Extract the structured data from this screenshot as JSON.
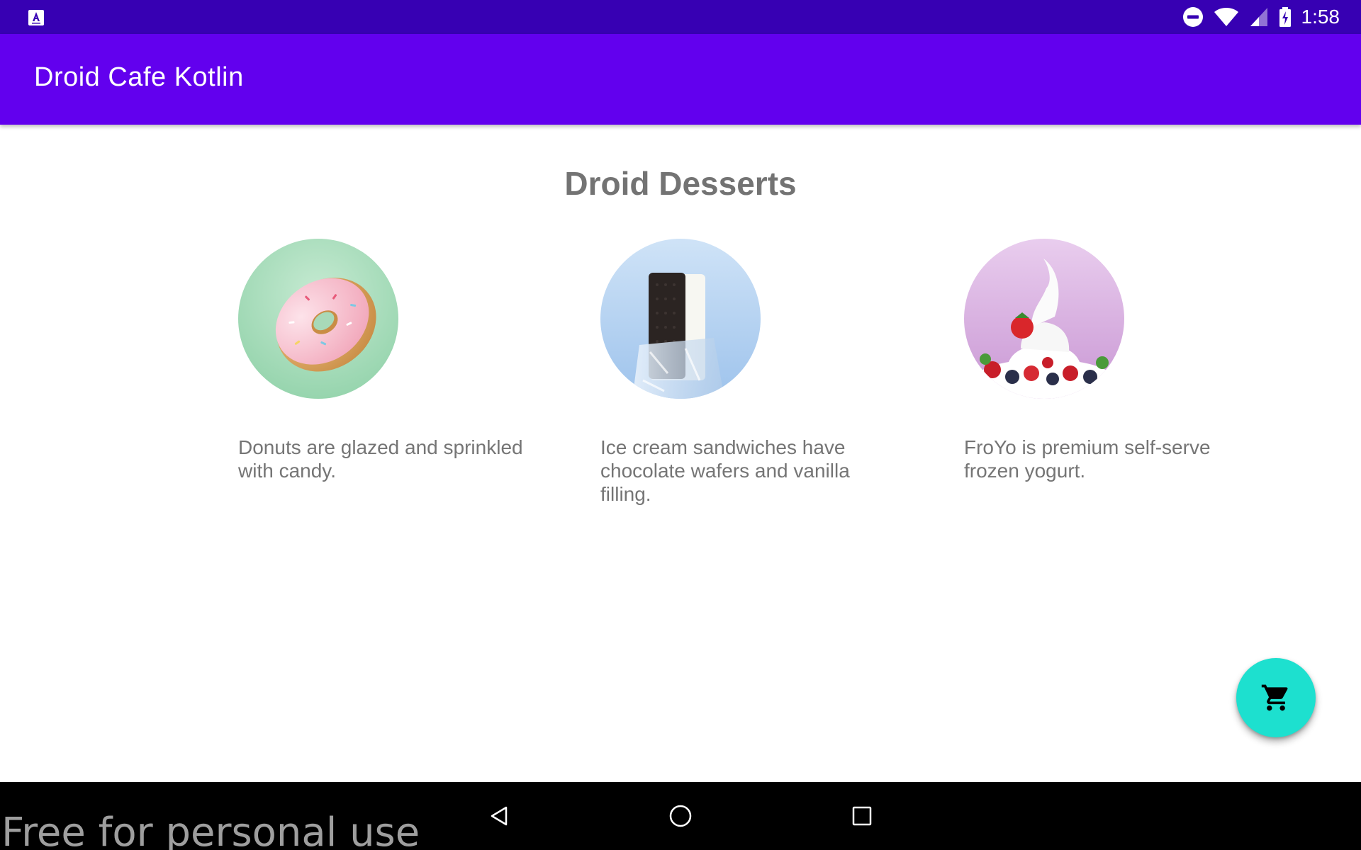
{
  "status_bar": {
    "time": "1:58",
    "left_icon": "app-notification-icon",
    "right_icons": [
      "do-not-disturb-icon",
      "wifi-icon",
      "cell-signal-icon",
      "battery-charging-icon"
    ],
    "background": "#3700b3"
  },
  "app_bar": {
    "title": "Droid Cafe Kotlin",
    "background": "#6200ee"
  },
  "main": {
    "heading": "Droid Desserts",
    "desserts": [
      {
        "name": "donut",
        "description": "Donuts are glazed and sprinkled with candy."
      },
      {
        "name": "ice-cream-sandwich",
        "description": "Ice cream sandwiches have chocolate wafers and vanilla filling."
      },
      {
        "name": "froyo",
        "description": "FroYo is premium self-serve frozen yogurt."
      }
    ]
  },
  "fab": {
    "icon": "shopping-cart-icon",
    "color": "#1de0cf"
  },
  "nav_bar": {
    "buttons": [
      "back-icon",
      "home-icon",
      "recents-icon"
    ],
    "watermark": "Free for personal use"
  }
}
